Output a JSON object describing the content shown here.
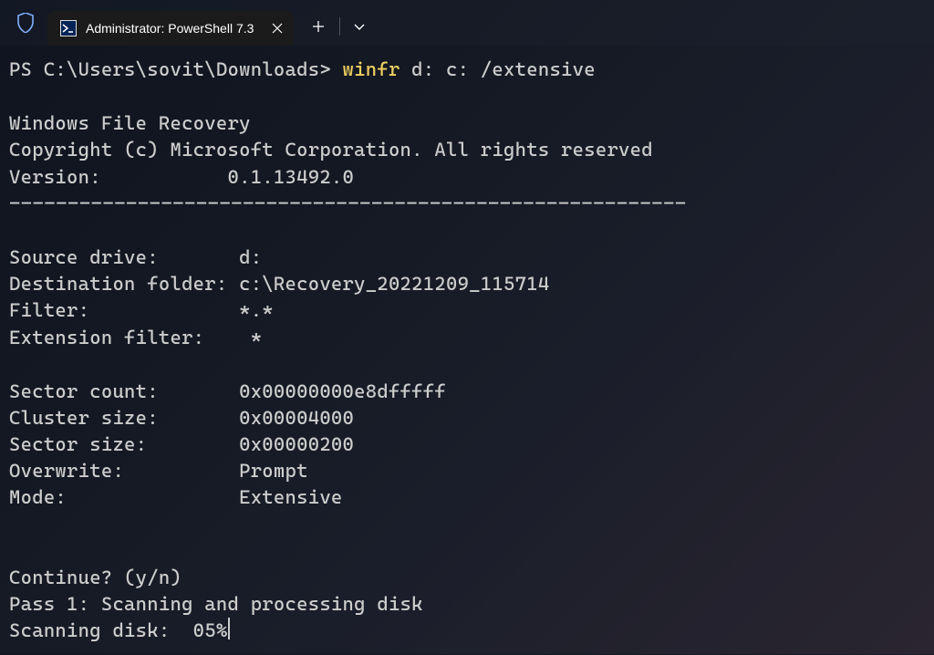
{
  "titlebar": {
    "tab_title": "Administrator: PowerShell 7.3"
  },
  "terminal": {
    "prompt": "PS C:\\Users\\sovit\\Downloads> ",
    "command": "winfr",
    "args": " d: c: /extensive",
    "header": {
      "title": "Windows File Recovery",
      "copyright": "Copyright (c) Microsoft Corporation. All rights reserved",
      "version_label": "Version:           0.1.13492.0"
    },
    "divider": "----------------------------------------------------------",
    "info": {
      "source_drive": "Source drive:       d:",
      "destination_folder": "Destination folder: c:\\Recovery_20221209_115714",
      "filter": "Filter:             *.*",
      "extension_filter": "Extension filter:    *"
    },
    "details": {
      "sector_count": "Sector count:       0x00000000e8dfffff",
      "cluster_size": "Cluster size:       0x00004000",
      "sector_size": "Sector size:        0x00000200",
      "overwrite": "Overwrite:          Prompt",
      "mode": "Mode:               Extensive"
    },
    "progress": {
      "continue": "Continue? (y/n)",
      "pass": "Pass 1: Scanning and processing disk",
      "scanning": "Scanning disk:  05%"
    }
  }
}
